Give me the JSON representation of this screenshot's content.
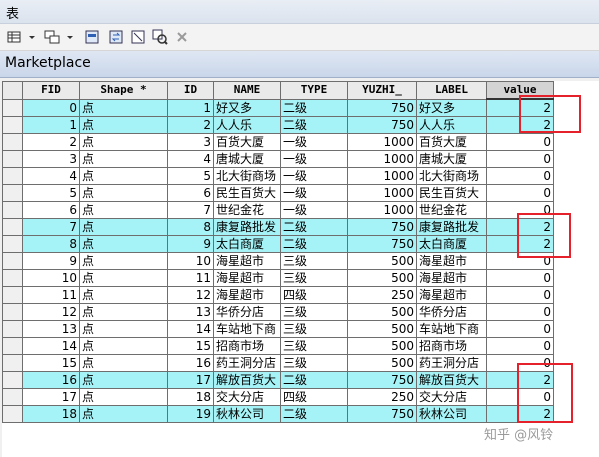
{
  "window": {
    "title": "表"
  },
  "toolbar": {
    "icons": [
      "table-options-icon",
      "related-tables-icon",
      "select-by-attributes-icon",
      "switch-selection-icon",
      "clear-selection-icon",
      "zoom-to-selected-icon",
      "delete-selected-icon"
    ]
  },
  "tab": {
    "label": "Marketplace"
  },
  "table": {
    "columns": [
      "FID",
      "Shape *",
      "ID",
      "NAME",
      "TYPE",
      "YUZHI_",
      "LABEL",
      "value"
    ],
    "rows": [
      [
        "0",
        "点",
        "1",
        "好又多",
        "二级",
        "750",
        "好又多",
        "2"
      ],
      [
        "1",
        "点",
        "2",
        "人人乐",
        "二级",
        "750",
        "人人乐",
        "2"
      ],
      [
        "2",
        "点",
        "3",
        "百货大厦",
        "一级",
        "1000",
        "百货大厦",
        "0"
      ],
      [
        "3",
        "点",
        "4",
        "唐城大厦",
        "一级",
        "1000",
        "唐城大厦",
        "0"
      ],
      [
        "4",
        "点",
        "5",
        "北大街商场",
        "一级",
        "1000",
        "北大街商场",
        "0"
      ],
      [
        "5",
        "点",
        "6",
        "民生百货大",
        "一级",
        "1000",
        "民生百货大",
        "0"
      ],
      [
        "6",
        "点",
        "7",
        "世纪金花",
        "一级",
        "1000",
        "世纪金花",
        "0"
      ],
      [
        "7",
        "点",
        "8",
        "康复路批发",
        "二级",
        "750",
        "康复路批发",
        "2"
      ],
      [
        "8",
        "点",
        "9",
        "太白商厦",
        "二级",
        "750",
        "太白商厦",
        "2"
      ],
      [
        "9",
        "点",
        "10",
        "海星超市",
        "三级",
        "500",
        "海星超市",
        "0"
      ],
      [
        "10",
        "点",
        "11",
        "海星超市",
        "三级",
        "500",
        "海星超市",
        "0"
      ],
      [
        "11",
        "点",
        "12",
        "海星超市",
        "四级",
        "250",
        "海星超市",
        "0"
      ],
      [
        "12",
        "点",
        "13",
        "华侨分店",
        "三级",
        "500",
        "华侨分店",
        "0"
      ],
      [
        "13",
        "点",
        "14",
        "车站地下商",
        "三级",
        "500",
        "车站地下商",
        "0"
      ],
      [
        "14",
        "点",
        "15",
        "招商市场",
        "三级",
        "500",
        "招商市场",
        "0"
      ],
      [
        "15",
        "点",
        "16",
        "药王洞分店",
        "三级",
        "500",
        "药王洞分店",
        "0"
      ],
      [
        "16",
        "点",
        "17",
        "解放百货大",
        "二级",
        "750",
        "解放百货大",
        "2"
      ],
      [
        "17",
        "点",
        "18",
        "交大分店",
        "四级",
        "250",
        "交大分店",
        "0"
      ],
      [
        "18",
        "点",
        "19",
        "秋林公司",
        "二级",
        "750",
        "秋林公司",
        "2"
      ]
    ],
    "highlighted_rows": [
      0,
      1,
      7,
      8,
      16,
      18
    ]
  },
  "watermark": "知乎 @风铃",
  "colors": {
    "highlight": "#a6f3f7",
    "annotation": "#e5212b"
  }
}
